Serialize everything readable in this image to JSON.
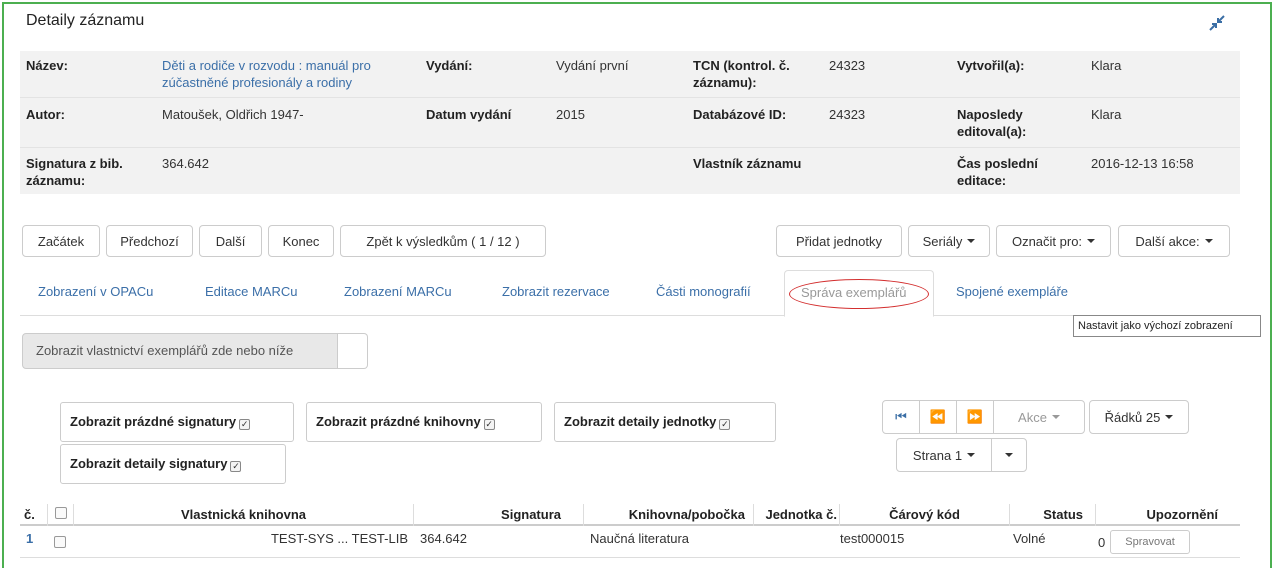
{
  "page": {
    "title": "Detaily záznamu"
  },
  "details": {
    "row1": {
      "nazev_label": "Název:",
      "nazev_value_line1": "Děti a rodiče v rozvodu : manuál pro",
      "nazev_value_line2": "zúčastněné profesionály a rodiny",
      "vydani_label": "Vydání:",
      "vydani_value": "Vydání první",
      "tcn_label_line1": "TCN (kontrol. č.",
      "tcn_label_line2": "záznamu):",
      "tcn_value": "24323",
      "vytvoril_label": "Vytvořil(a):",
      "vytvoril_value": "Klara"
    },
    "row2": {
      "autor_label": "Autor:",
      "autor_value": "Matoušek, Oldřich 1947-",
      "datum_label": "Datum vydání",
      "datum_value": "2015",
      "db_label": "Databázové ID:",
      "db_value": "24323",
      "naposledy_label_line1": "Naposledy",
      "naposledy_label_line2": "editoval(a):",
      "naposledy_value": "Klara"
    },
    "row3": {
      "signatura_label_line1": "Signatura z bib.",
      "signatura_label_line2": "záznamu:",
      "signatura_value": "364.642",
      "vlastnik_label": "Vlastník záznamu",
      "cas_label_line1": "Čas poslední",
      "cas_label_line2": "editace:",
      "cas_value": "2016-12-13 16:58"
    }
  },
  "toolbar": {
    "zacatek": "Začátek",
    "predchozi": "Předchozí",
    "dalsi": "Další",
    "konec": "Konec",
    "zpet": "Zpět k výsledkům ( 1 / 12 )",
    "pridat": "Přidat jednotky",
    "serialy": "Seriály",
    "oznacit": "Označit pro:",
    "dalsi_akce": "Další akce:"
  },
  "tabs": [
    {
      "label": "Zobrazení v OPACu"
    },
    {
      "label": "Editace MARCu"
    },
    {
      "label": "Zobrazení MARCu"
    },
    {
      "label": "Zobrazit rezervace"
    },
    {
      "label": "Části monografií"
    },
    {
      "label": "Správa exemplářů"
    },
    {
      "label": "Spojené exempláře"
    }
  ],
  "tooltip": "Nastavit jako výchozí zobrazení",
  "owning_button": "Zobrazit vlastnictví exemplářů zde nebo níže",
  "options": {
    "empty_callnumbers": "Zobrazit prázdné signatury",
    "empty_libraries": "Zobrazit prázdné knihovny",
    "unit_details": "Zobrazit detaily jednotky",
    "callnumber_details": "Zobrazit detaily signatury",
    "check_mark": "✓"
  },
  "pager": {
    "first": "⏮",
    "prev": "⏪",
    "next": "⏩",
    "akce": "Akce",
    "rows": "Řádků 25",
    "page": "Strana 1"
  },
  "table": {
    "headers": {
      "num": "č.",
      "owning_lib": "Vlastnická knihovna",
      "callnumber": "Signatura",
      "branch": "Knihovna/pobočka",
      "unit": "Jednotka č.",
      "barcode": "Čárový kód",
      "status": "Status",
      "alerts": "Upozornění"
    },
    "rows": [
      {
        "num": "1",
        "owning_lib": "TEST-SYS ... TEST-LIB",
        "callnumber": "364.642",
        "branch": "Naučná literatura",
        "unit": "",
        "barcode": "test000015",
        "status": "Volné",
        "alert_count": "0",
        "alert_button": "Spravovat"
      }
    ]
  },
  "colors": {
    "frame": "#4caf50",
    "link": "#3b6fa8",
    "highlight_circle": "#d32f2f"
  },
  "icons": {
    "collapse": "compress-icon",
    "first": "first-page-icon",
    "prev": "prev-page-icon",
    "next": "next-page-icon"
  }
}
